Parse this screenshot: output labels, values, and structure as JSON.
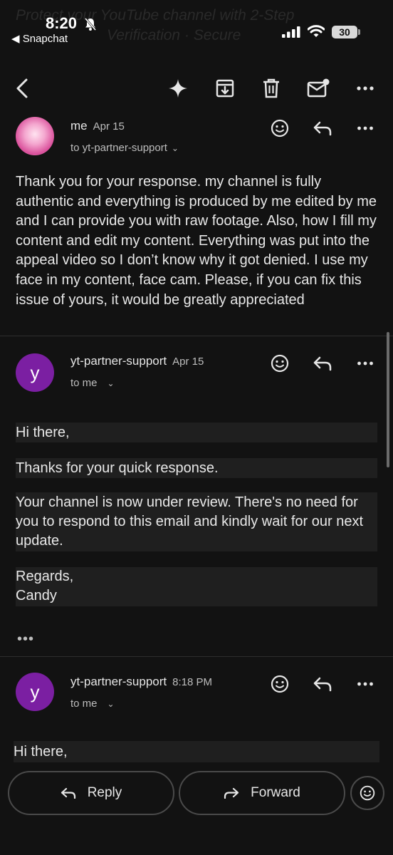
{
  "status_bar": {
    "time": "8:20",
    "back_app": "◀ Snapchat",
    "battery": "30",
    "ghost_subject_line1": "Protect your YouTube channel with 2-Step",
    "ghost_subject_line2": "Verification · Secure"
  },
  "messages": [
    {
      "sender": "me",
      "date": "Apr 15",
      "recipient": "to yt-partner-support",
      "body": "Thank you for your response. my channel is fully authentic and everything is produced by me edited by me and I can provide you with raw footage. Also, how I fill my content and edit my content. Everything was put into the appeal video so I don’t know why it got denied. I use my face in my content, face cam. Please, if you can fix this issue of yours, it would be greatly appreciated"
    },
    {
      "avatar_letter": "y",
      "sender": "yt-partner-support",
      "date": "Apr 15",
      "recipient": "to me",
      "greeting": "Hi there,",
      "line1": "Thanks for your quick response.",
      "line2": "Your channel is now under review. There's no need for you to respond to this email and kindly wait for our next update.",
      "regards": "Regards,",
      "signature": "Candy",
      "more": "•••"
    },
    {
      "avatar_letter": "y",
      "sender": "yt-partner-support",
      "date": "8:18 PM",
      "recipient": "to me",
      "greeting": "Hi there,"
    }
  ],
  "bottom_bar": {
    "reply_label": "Reply",
    "forward_label": "Forward"
  }
}
